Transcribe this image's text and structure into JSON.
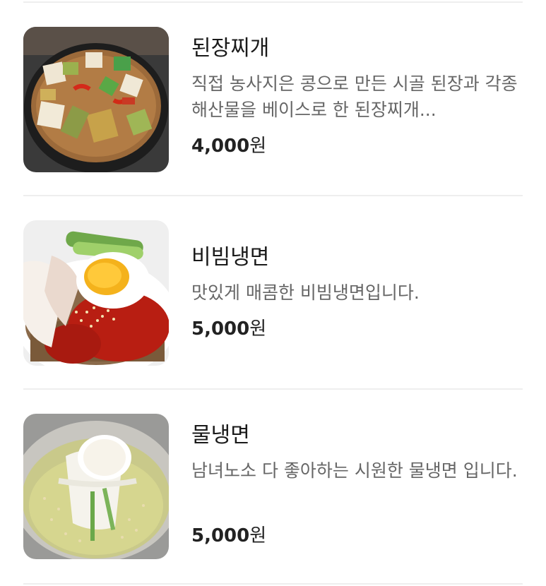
{
  "menu_items": [
    {
      "name": "된장찌개",
      "description": "직접 농사지은 콩으로 만든 시골 된장과 각종 해산물을 베이스로 한 된장찌개...",
      "price_amount": "4,000",
      "price_unit": "원",
      "image_icon": "doenjang-stew-photo"
    },
    {
      "name": "비빔냉면",
      "description": "맛있게 매콤한 비빔냉면입니다.",
      "price_amount": "5,000",
      "price_unit": "원",
      "image_icon": "bibim-naengmyeon-photo"
    },
    {
      "name": "물냉면",
      "description": "남녀노소 다 좋아하는 시원한 물냉면 입니다.",
      "price_amount": "5,000",
      "price_unit": "원",
      "image_icon": "mul-naengmyeon-photo"
    }
  ],
  "colors": {
    "divider": "#eeeeee",
    "name_text": "#1a1a1a",
    "description_text": "#666666",
    "price_text": "#222222"
  }
}
